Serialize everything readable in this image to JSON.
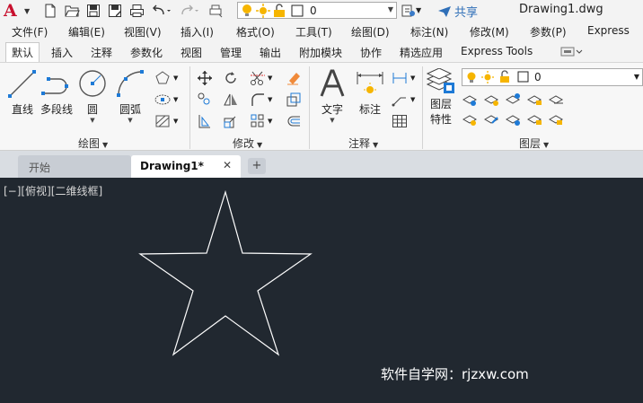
{
  "qat": {
    "app_letter": "A",
    "layer_value": "0",
    "share_label": "共享",
    "document_title": "Drawing1.dwg"
  },
  "menubar": {
    "items": [
      "文件(F)",
      "编辑(E)",
      "视图(V)",
      "插入(I)",
      "格式(O)",
      "工具(T)",
      "绘图(D)",
      "标注(N)",
      "修改(M)",
      "参数(P)",
      "Express"
    ]
  },
  "ribbon_tabs": {
    "items": [
      "默认",
      "插入",
      "注释",
      "参数化",
      "视图",
      "管理",
      "输出",
      "附加模块",
      "协作",
      "精选应用",
      "Express Tools"
    ],
    "active": "默认"
  },
  "ribbon": {
    "draw": {
      "title": "绘图",
      "tools": [
        "直线",
        "多段线",
        "圆",
        "圆弧"
      ]
    },
    "modify": {
      "title": "修改"
    },
    "annotation": {
      "title": "注释",
      "tools": [
        "文字",
        "标注"
      ]
    },
    "layers": {
      "title": "图层",
      "properties_line1": "图层",
      "properties_line2": "特性",
      "layer_value": "0"
    }
  },
  "doc_tabs": {
    "items": [
      "开始",
      "Drawing1*"
    ],
    "active": "Drawing1*",
    "add_label": "+",
    "close_label": "✕"
  },
  "canvas": {
    "viewport_label": "[−][俯视][二维线框]",
    "watermark": "软件自学网：rjzxw.com",
    "colors": {
      "background": "#212830",
      "star_stroke": "#ffffff"
    }
  }
}
